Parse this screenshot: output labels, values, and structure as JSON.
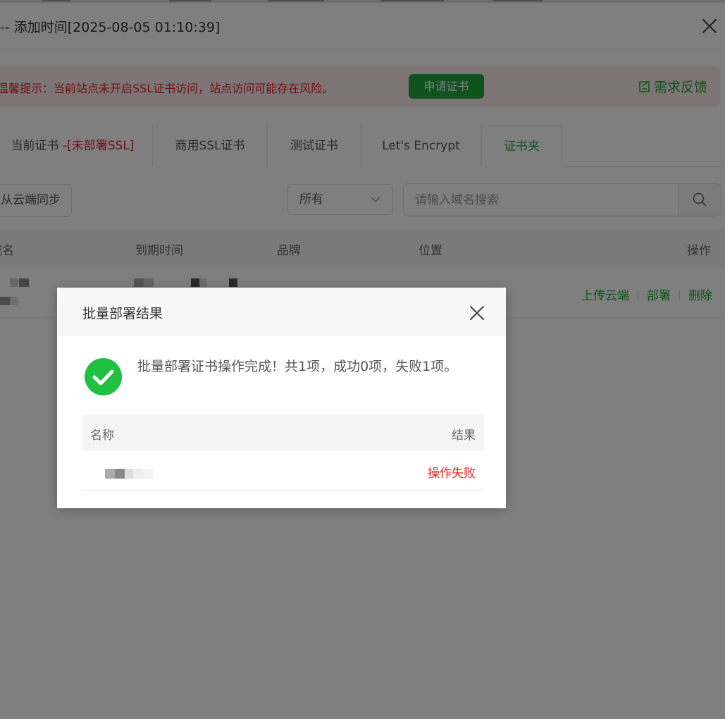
{
  "header": {
    "title": "-- 添加时间[2025-08-05 01:10:39]"
  },
  "banner": {
    "text": "温馨提示：当前站点未开启SSL证书访问，站点访问可能存在风险。",
    "apply_button": "申请证书",
    "feedback": "需求反馈"
  },
  "tabs": [
    {
      "label": "当前证书 -",
      "warn": "[未部署SSL]"
    },
    {
      "label": "商用SSL证书"
    },
    {
      "label": "测试证书"
    },
    {
      "label": "Let's Encrypt"
    },
    {
      "label": "证书夹",
      "active": true
    }
  ],
  "toolbar": {
    "sync_button": "从云端同步",
    "filter_value": "所有",
    "search_placeholder": "请输入域名搜索"
  },
  "table": {
    "columns": [
      "域名",
      "到期时间",
      "品牌",
      "位置",
      "操作"
    ],
    "row_actions": [
      "上传云端",
      "部署",
      "删除"
    ]
  },
  "dialog": {
    "title": "批量部署结果",
    "message": "批量部署证书操作完成！共1项，成功0项，失败1项。",
    "columns": [
      "名称",
      "结果"
    ],
    "rows": [
      {
        "result": "操作失败"
      }
    ]
  },
  "colors": {
    "accent": "#20a53a",
    "danger": "#e02020",
    "banner_bg": "#fbeaea"
  }
}
